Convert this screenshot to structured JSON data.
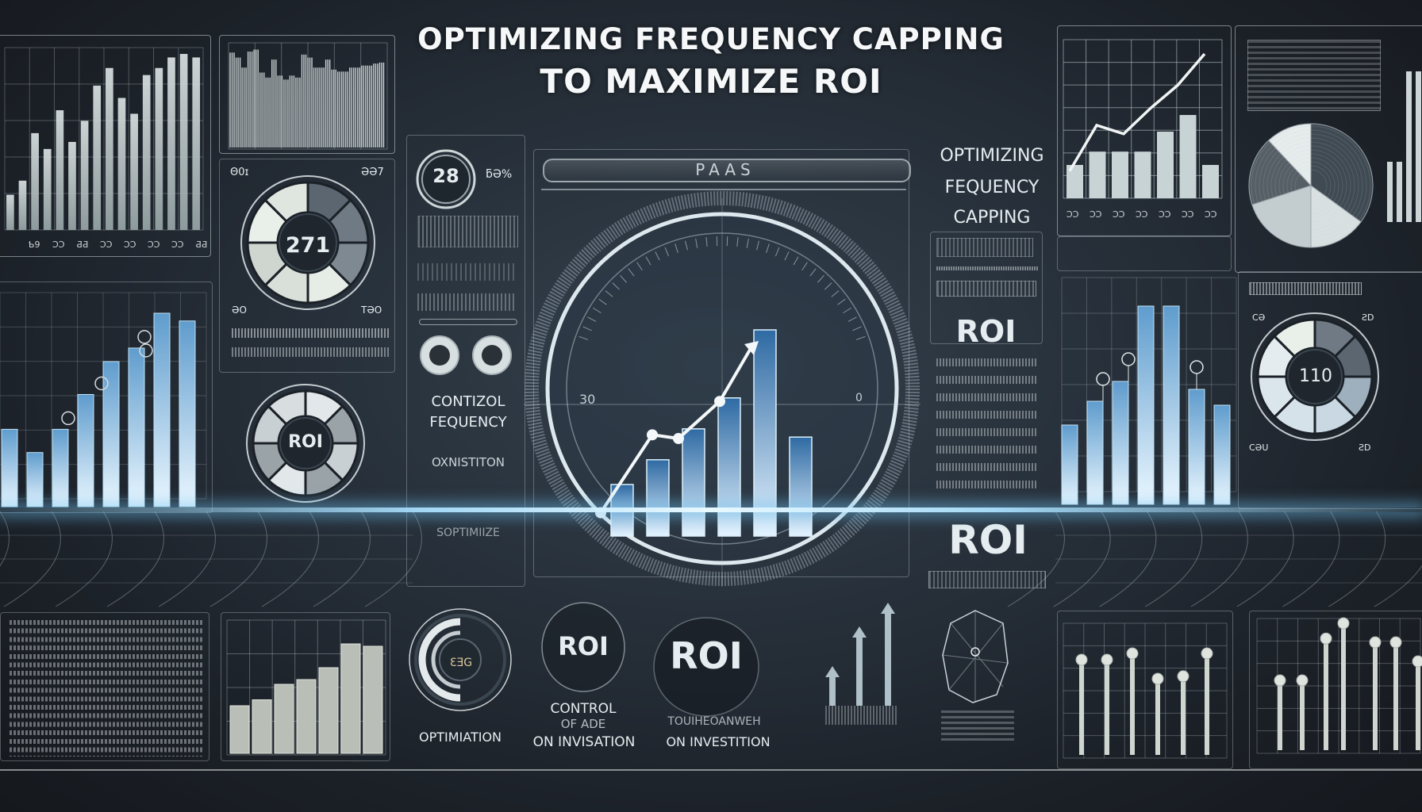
{
  "header": {
    "title_line1": "OPTIMIZING FREQUENCY CAPPING",
    "title_line2": "TO MAXIMIZE ROI"
  },
  "side_heading": {
    "line1": "OPTIMIZING",
    "line2": "FEQUENCY",
    "line3": "CAPPING"
  },
  "labels": {
    "roi_right_panel": "ROI",
    "roi_right_large": "ROI",
    "roi_left_gauge": "ROI",
    "roi_bottom_small": "ROI",
    "roi_bottom_large": "ROI",
    "control_frequency_1": "CONTIZOL",
    "control_frequency_2": "FEQUENCY",
    "control_frequency_3": "OXNISTITON",
    "optimize_text": "SOPTIMIIZE",
    "optimization": "OPTIMIATION",
    "control_ads_1": "CONTROL",
    "control_ads_2": "OF ADE",
    "control_ads_3": "ON INVISATION",
    "return_investment_1": "TOUIHEOANWEH",
    "return_investment_2": "ON INVESTITION",
    "center_banner": "PAAS"
  },
  "gauges": {
    "top_left_value": "271",
    "top_left_corner_labels": [
      "Θ0ɪ",
      "ƏƏ7",
      "ƏO",
      "TƏO"
    ],
    "badge_value": "28",
    "badge_side_label": "ƃƏ%",
    "right_value": "110",
    "right_corner_labels": [
      "CƏ",
      "ƧD",
      "CƏU",
      "ƧD"
    ],
    "bottom_value": "ƐƎG",
    "center_scale_left": "30",
    "center_scale_right": "0"
  },
  "colors": {
    "accent_blue": "#7cc4ec",
    "bar_light": "#e6eef0",
    "bar_blue": "#3f7fb5",
    "panel_line": "#c8d2d7",
    "background": "#27303a"
  },
  "chart_data": [
    {
      "type": "bar",
      "title": "Top-left bar chart",
      "categories": [
        "",
        "Ƅ9",
        "ƆƆ",
        "ƋƋ",
        "ƆƆ",
        "ƆƆ",
        "ƆƆ",
        "ƆƆ",
        "ƋƋ"
      ],
      "values": [
        20,
        28,
        55,
        46,
        68,
        50,
        62,
        82,
        92,
        75,
        66,
        88,
        92,
        98,
        100,
        98
      ],
      "ylim": [
        0,
        100
      ]
    },
    {
      "type": "bar",
      "title": "Top-left waveform",
      "values": [
        95,
        90,
        80,
        96,
        98,
        75,
        70,
        88,
        72,
        68,
        72,
        70,
        93,
        90,
        80,
        80,
        88,
        78,
        76,
        76,
        80,
        80,
        82,
        82,
        84,
        85
      ],
      "ylim": [
        0,
        100
      ]
    },
    {
      "type": "bar",
      "title": "Left glowing bar chart",
      "values": [
        40,
        28,
        40,
        58,
        75,
        82,
        100,
        96
      ],
      "ylim": [
        0,
        100
      ]
    },
    {
      "type": "bar",
      "title": "Central ROI chart",
      "values": [
        25,
        37,
        52,
        67,
        100,
        48
      ],
      "line_values": [
        10,
        52,
        50,
        70,
        100
      ],
      "ylim": [
        0,
        100
      ]
    },
    {
      "type": "bar",
      "title": "Top-right line + bar chart",
      "categories": [
        "ƆƆ",
        "ƆƆ",
        "ƆƆ",
        "ƆƆ",
        "ƆƆ",
        "ƆƆ",
        "ƆƆ"
      ],
      "values": [
        30,
        42,
        42,
        42,
        60,
        75,
        30
      ],
      "line_values": [
        18,
        50,
        44,
        62,
        78,
        100
      ],
      "ylim": [
        0,
        100
      ]
    },
    {
      "type": "pie",
      "title": "Top-right pie",
      "values": [
        35,
        15,
        20,
        18,
        12
      ]
    },
    {
      "type": "bar",
      "title": "Right glowing bar chart",
      "values": [
        40,
        52,
        62,
        100,
        100,
        58,
        50
      ],
      "ylim": [
        0,
        100
      ]
    },
    {
      "type": "bar",
      "title": "Bottom-left stepped bars",
      "values": [
        40,
        45,
        58,
        62,
        72,
        92,
        90
      ],
      "ylim": [
        0,
        100
      ]
    },
    {
      "type": "bar",
      "title": "Bottom-right lollipop chart A",
      "values": [
        75,
        75,
        80,
        60,
        62,
        80
      ],
      "ylim": [
        0,
        100
      ]
    },
    {
      "type": "bar",
      "title": "Bottom-right lollipop chart B",
      "values": [
        55,
        55,
        88,
        100,
        85,
        85,
        70
      ],
      "ylim": [
        0,
        100
      ]
    }
  ]
}
